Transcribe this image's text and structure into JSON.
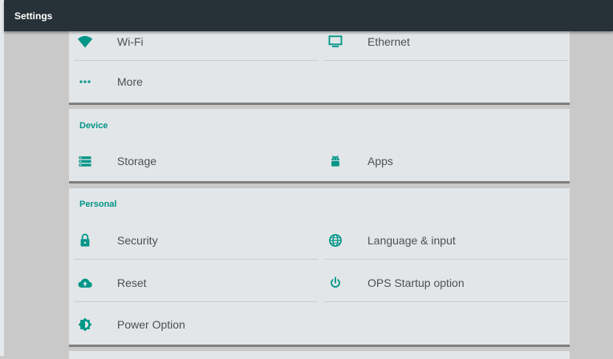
{
  "appbar": {
    "title": "Settings"
  },
  "colors": {
    "accent": "#009688",
    "appbar": "#273238",
    "card": "#e3e6e8",
    "background": "#c9c9c9"
  },
  "wireless": {
    "items": [
      {
        "label": "Wi-Fi",
        "icon": "wifi-icon"
      },
      {
        "label": "Ethernet",
        "icon": "monitor-icon"
      },
      {
        "label": "More",
        "icon": "more-dots-icon"
      }
    ]
  },
  "device": {
    "header": "Device",
    "items": [
      {
        "label": "Storage",
        "icon": "storage-icon"
      },
      {
        "label": "Apps",
        "icon": "android-icon"
      }
    ]
  },
  "personal": {
    "header": "Personal",
    "items": [
      {
        "label": "Security",
        "icon": "lock-icon"
      },
      {
        "label": "Language & input",
        "icon": "globe-icon"
      },
      {
        "label": "Reset",
        "icon": "cloud-upload-icon"
      },
      {
        "label": "OPS Startup option",
        "icon": "power-icon"
      },
      {
        "label": "Power Option",
        "icon": "brightness-icon"
      }
    ]
  }
}
